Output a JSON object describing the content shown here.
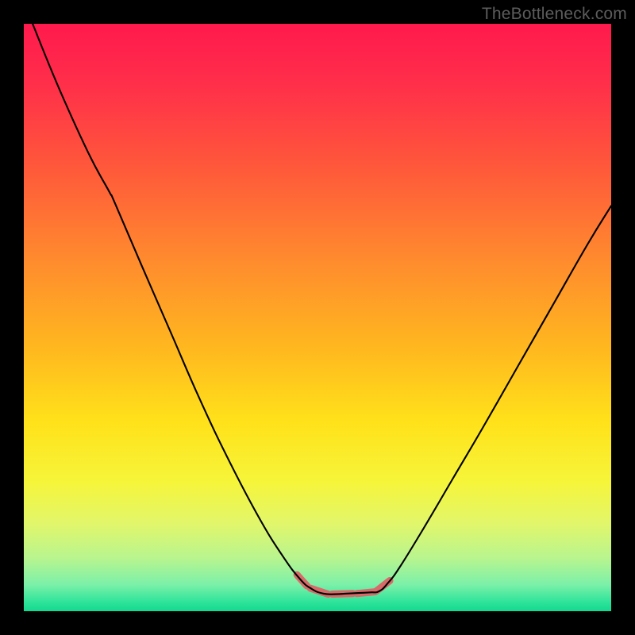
{
  "watermark": "TheBottleneck.com",
  "chart_data": {
    "type": "line",
    "title": "",
    "xlabel": "",
    "ylabel": "",
    "xlim": [
      0,
      100
    ],
    "ylim": [
      0,
      100
    ],
    "background_gradient_stops": [
      {
        "offset": 0.0,
        "color": "#ff1a4d"
      },
      {
        "offset": 0.1,
        "color": "#ff2e4a"
      },
      {
        "offset": 0.25,
        "color": "#ff5a3a"
      },
      {
        "offset": 0.4,
        "color": "#ff8a2e"
      },
      {
        "offset": 0.55,
        "color": "#ffb71f"
      },
      {
        "offset": 0.68,
        "color": "#ffe21a"
      },
      {
        "offset": 0.78,
        "color": "#f6f53a"
      },
      {
        "offset": 0.85,
        "color": "#e2f66a"
      },
      {
        "offset": 0.91,
        "color": "#b8f58f"
      },
      {
        "offset": 0.955,
        "color": "#7bf0a8"
      },
      {
        "offset": 0.985,
        "color": "#2de39a"
      },
      {
        "offset": 1.0,
        "color": "#13d98e"
      }
    ],
    "curve_points_xy": [
      [
        1.5,
        100.0
      ],
      [
        6.0,
        89.0
      ],
      [
        11.0,
        78.0
      ],
      [
        14.5,
        71.5
      ],
      [
        15.5,
        69.5
      ],
      [
        20.0,
        59.0
      ],
      [
        25.0,
        47.5
      ],
      [
        30.0,
        36.0
      ],
      [
        35.0,
        25.5
      ],
      [
        40.0,
        16.0
      ],
      [
        44.0,
        9.5
      ],
      [
        47.0,
        5.5
      ],
      [
        49.0,
        3.8
      ],
      [
        51.0,
        3.0
      ],
      [
        53.0,
        2.9
      ],
      [
        55.0,
        3.0
      ],
      [
        57.0,
        3.1
      ],
      [
        59.0,
        3.2
      ],
      [
        60.5,
        3.4
      ],
      [
        62.0,
        4.8
      ],
      [
        64.0,
        7.5
      ],
      [
        68.0,
        14.0
      ],
      [
        73.0,
        22.5
      ],
      [
        78.0,
        31.0
      ],
      [
        84.0,
        41.5
      ],
      [
        90.0,
        52.0
      ],
      [
        96.0,
        62.5
      ],
      [
        100.0,
        69.0
      ]
    ],
    "highlight_stroke_color": "#d86a6a",
    "highlight_segments_xy": [
      [
        [
          46.5,
          6.2
        ],
        [
          48.2,
          4.3
        ]
      ],
      [
        [
          48.8,
          3.9
        ],
        [
          51.8,
          2.9
        ]
      ],
      [
        [
          52.5,
          2.9
        ],
        [
          56.0,
          3.0
        ]
      ],
      [
        [
          56.7,
          3.0
        ],
        [
          59.8,
          3.3
        ]
      ],
      [
        [
          60.0,
          3.4
        ],
        [
          62.3,
          5.2
        ]
      ]
    ],
    "curve_stroke_color": "#000000",
    "curve_stroke_width": 2.1,
    "highlight_stroke_width": 9
  }
}
